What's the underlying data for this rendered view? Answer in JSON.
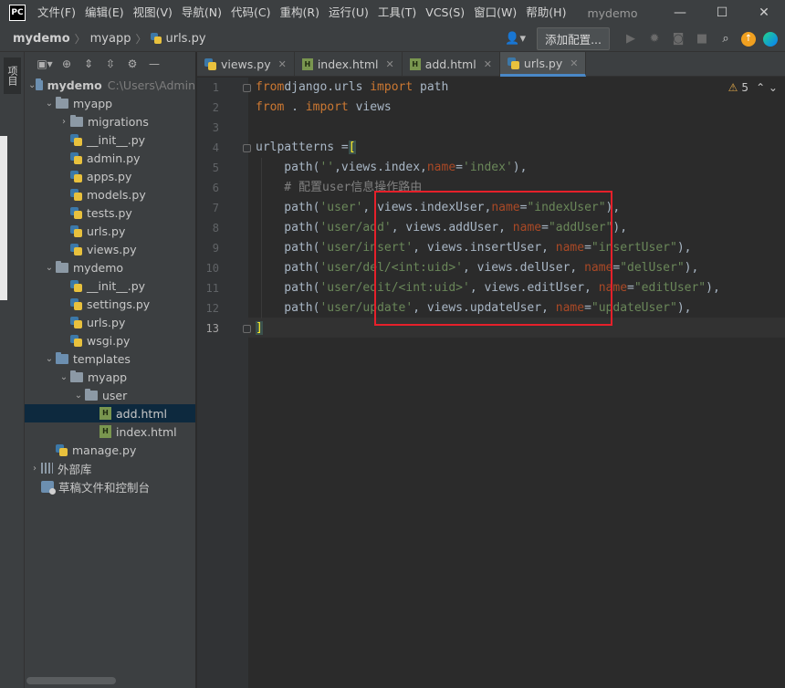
{
  "titlebar": {
    "logo": "PC",
    "menus": [
      "文件(F)",
      "编辑(E)",
      "视图(V)",
      "导航(N)",
      "代码(C)",
      "重构(R)",
      "运行(U)",
      "工具(T)",
      "VCS(S)",
      "窗口(W)",
      "帮助(H)"
    ],
    "title": "mydemo",
    "minimize": "—",
    "maximize": "☐",
    "close": "✕"
  },
  "navbar": {
    "crumbs": [
      "mydemo",
      "myapp",
      "urls.py"
    ],
    "add_config": "添加配置..."
  },
  "left_strip": {
    "project_tab": "项目"
  },
  "project": {
    "tree": [
      {
        "label": "mydemo",
        "hint": "C:\\Users\\Admin",
        "level": 0,
        "type": "folder-blue",
        "expanded": true,
        "bold": true
      },
      {
        "label": "myapp",
        "level": 1,
        "type": "folder",
        "expanded": true
      },
      {
        "label": "migrations",
        "level": 2,
        "type": "folder",
        "expanded": false
      },
      {
        "label": "__init__.py",
        "level": 2,
        "type": "py"
      },
      {
        "label": "admin.py",
        "level": 2,
        "type": "py"
      },
      {
        "label": "apps.py",
        "level": 2,
        "type": "py"
      },
      {
        "label": "models.py",
        "level": 2,
        "type": "py"
      },
      {
        "label": "tests.py",
        "level": 2,
        "type": "py"
      },
      {
        "label": "urls.py",
        "level": 2,
        "type": "py"
      },
      {
        "label": "views.py",
        "level": 2,
        "type": "py"
      },
      {
        "label": "mydemo",
        "level": 1,
        "type": "folder",
        "expanded": true
      },
      {
        "label": "__init__.py",
        "level": 2,
        "type": "py"
      },
      {
        "label": "settings.py",
        "level": 2,
        "type": "py"
      },
      {
        "label": "urls.py",
        "level": 2,
        "type": "py"
      },
      {
        "label": "wsgi.py",
        "level": 2,
        "type": "py"
      },
      {
        "label": "templates",
        "level": 1,
        "type": "folder-blue",
        "expanded": true
      },
      {
        "label": "myapp",
        "level": 2,
        "type": "folder",
        "expanded": true
      },
      {
        "label": "user",
        "level": 3,
        "type": "folder",
        "expanded": true
      },
      {
        "label": "add.html",
        "level": 4,
        "type": "html",
        "selected": true
      },
      {
        "label": "index.html",
        "level": 4,
        "type": "html"
      },
      {
        "label": "manage.py",
        "level": 1,
        "type": "py"
      },
      {
        "label": "外部库",
        "level": 0,
        "type": "lib",
        "expanded": false
      },
      {
        "label": "草稿文件和控制台",
        "level": 0,
        "type": "scratch"
      }
    ]
  },
  "tabs": [
    {
      "label": "views.py",
      "type": "py",
      "active": false
    },
    {
      "label": "index.html",
      "type": "html",
      "active": false
    },
    {
      "label": "add.html",
      "type": "html",
      "active": false
    },
    {
      "label": "urls.py",
      "type": "py",
      "active": true
    }
  ],
  "editor": {
    "warning_count": "5",
    "line_numbers": [
      "1",
      "2",
      "3",
      "4",
      "5",
      "6",
      "7",
      "8",
      "9",
      "10",
      "11",
      "12",
      "13"
    ],
    "lines": [
      [
        [
          "kw",
          "from"
        ],
        [
          "",
          "django.urls "
        ],
        [
          "kw",
          "import"
        ],
        [
          "",
          " path"
        ]
      ],
      [
        [
          "kw",
          "from"
        ],
        [
          "",
          " . "
        ],
        [
          "kw",
          "import"
        ],
        [
          "",
          " views"
        ]
      ],
      [],
      [
        [
          "",
          "urlpatterns ="
        ],
        [
          "brk",
          "["
        ]
      ],
      [
        [
          "",
          "    path("
        ],
        [
          "str",
          "''"
        ],
        [
          "",
          ",views.index,"
        ],
        [
          "param",
          "name"
        ],
        [
          "",
          "="
        ],
        [
          "str",
          "'index'"
        ],
        [
          "",
          "),"
        ]
      ],
      [
        [
          "cmt",
          "    # 配置user信息操作路由"
        ]
      ],
      [
        [
          "",
          "    path("
        ],
        [
          "str",
          "'user'"
        ],
        [
          "",
          ", views.indexUser,"
        ],
        [
          "param",
          "name"
        ],
        [
          "",
          "="
        ],
        [
          "str",
          "\"indexUser\""
        ],
        [
          "",
          "),"
        ]
      ],
      [
        [
          "",
          "    path("
        ],
        [
          "str",
          "'user/add'"
        ],
        [
          "",
          ", views.addUser, "
        ],
        [
          "param",
          "name"
        ],
        [
          "",
          "="
        ],
        [
          "str",
          "\"addUser\""
        ],
        [
          "",
          "),"
        ]
      ],
      [
        [
          "",
          "    path("
        ],
        [
          "str",
          "'user/insert'"
        ],
        [
          "",
          ", views.insertUser, "
        ],
        [
          "param",
          "name"
        ],
        [
          "",
          "="
        ],
        [
          "str",
          "\"insertUser\""
        ],
        [
          "",
          "),"
        ]
      ],
      [
        [
          "",
          "    path("
        ],
        [
          "str",
          "'user/del/<int:uid>'"
        ],
        [
          "",
          ", views.delUser, "
        ],
        [
          "param",
          "name"
        ],
        [
          "",
          "="
        ],
        [
          "str",
          "\"delUser\""
        ],
        [
          "",
          "),"
        ]
      ],
      [
        [
          "",
          "    path("
        ],
        [
          "str",
          "'user/edit/<int:uid>'"
        ],
        [
          "",
          ", views.editUser, "
        ],
        [
          "param",
          "name"
        ],
        [
          "",
          "="
        ],
        [
          "str",
          "\"editUser\""
        ],
        [
          "",
          "),"
        ]
      ],
      [
        [
          "",
          "    path("
        ],
        [
          "str",
          "'user/update'"
        ],
        [
          "",
          ", views.updateUser, "
        ],
        [
          "param",
          "name"
        ],
        [
          "",
          "="
        ],
        [
          "str",
          "\"updateUser\""
        ],
        [
          "",
          "),"
        ]
      ],
      [
        [
          "brk",
          "]"
        ]
      ]
    ]
  }
}
